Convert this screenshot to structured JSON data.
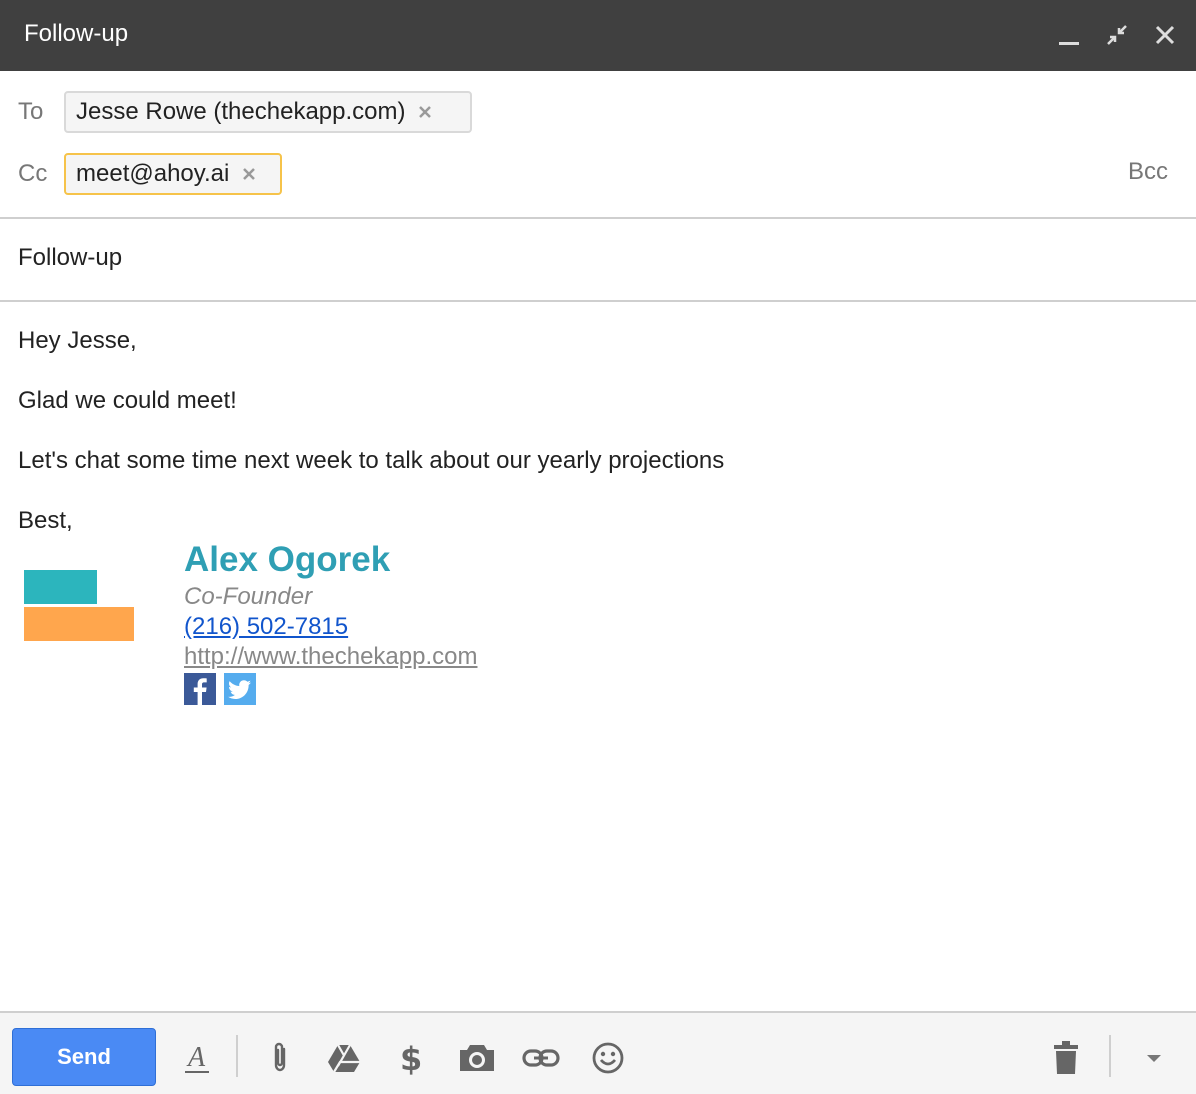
{
  "window": {
    "title": "Follow-up"
  },
  "recipients": {
    "to_label": "To",
    "to_chip": "Jesse Rowe (thechekapp.com)",
    "cc_label": "Cc",
    "cc_chip": "meet@ahoy.ai",
    "bcc_label": "Bcc"
  },
  "subject": "Follow-up",
  "body": {
    "greeting": "Hey Jesse,",
    "line1": "Glad we could meet!",
    "line2": "Let's chat some time next week to talk about our yearly projections",
    "closing": "Best,"
  },
  "signature": {
    "name": "Alex Ogorek",
    "role": "Co-Founder",
    "phone": "(216) 502-7815",
    "url": "http://www.thechekapp.com",
    "social": [
      "facebook-icon",
      "twitter-icon"
    ]
  },
  "toolbar": {
    "send_label": "Send",
    "icons": [
      "formatting-icon",
      "attach-icon",
      "drive-icon",
      "money-icon",
      "photo-icon",
      "link-icon",
      "emoji-icon",
      "trash-icon",
      "more-options-icon"
    ]
  },
  "colors": {
    "titlebar": "#404040",
    "accent_teal": "#2f9fb4",
    "logo_teal": "#2cb5bd",
    "logo_orange": "#ffa64d",
    "link_blue": "#1155cc",
    "send_blue": "#4a8af4",
    "facebook": "#3b5998",
    "twitter": "#55acee",
    "chip_focus": "#f6c34a"
  }
}
